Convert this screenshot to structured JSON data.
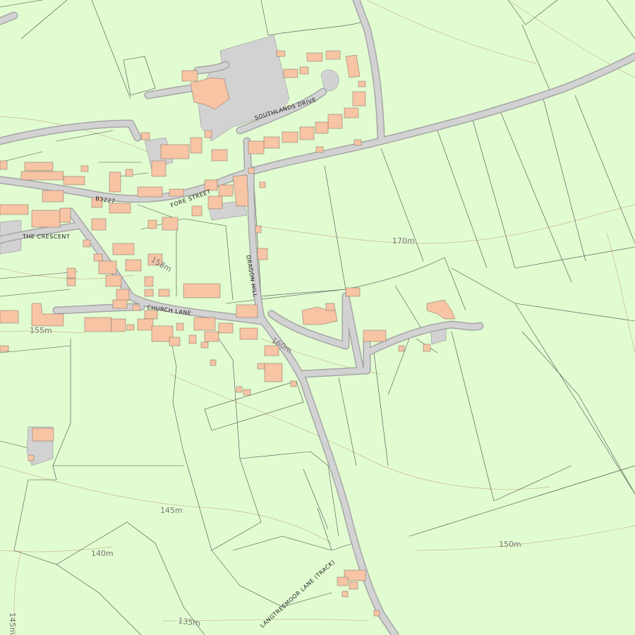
{
  "map": {
    "street_labels": {
      "southlands_drive": "SOUTHLANDS DRIVE",
      "fore_street": "FORE STREET",
      "b3227": "B3227",
      "the_crescent": "THE CRESCENT",
      "dragon_hill": "DRAGON HILL",
      "church_lane": "CHURCH LANE",
      "langtreemoor_lane": "LANGTREEMOOR LANE (TRACK)"
    },
    "contour_labels": {
      "c170": "170m",
      "c155": "155m",
      "c158": "158m",
      "c160": "160m",
      "c145_center": "145m",
      "c140": "140m",
      "c150": "150m",
      "c135": "135m",
      "c145_left": "145m"
    },
    "colors": {
      "background": "#e2fcd2",
      "building": "#f7c4a4",
      "road": "#d2d2d2",
      "boundary": "#4a4a4a",
      "contour": "#c9b98a"
    }
  }
}
